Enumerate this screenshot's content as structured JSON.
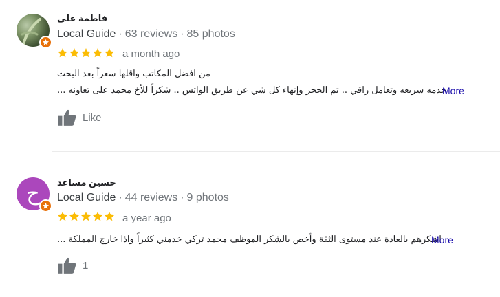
{
  "reviews": [
    {
      "author": "فاطمة علي",
      "guide_label": "Local Guide",
      "reviews_count": "63 reviews",
      "photos_count": "85 photos",
      "rating": 5,
      "time": "a month ago",
      "text_line1": "من افضل المكاتب واقلها سعراً بعد البحث",
      "text_line2": "خدمه سريعه وتعامل راقي .. تم الحجز وإنهاء كل شي عن طريق الواتس .. شكراً للأخ محمد على تعاونه ...",
      "more_label": "More",
      "like_label": "Like"
    },
    {
      "author": "حسين مساعد",
      "avatar_letter": "ح",
      "guide_label": "Local Guide",
      "reviews_count": "44 reviews",
      "photos_count": "9 photos",
      "rating": 5,
      "time": "a year ago",
      "text_line1": "اشكرهم بالعادة عند مستوى الثقة وأخص بالشكر الموظف محمد تركي خدمني كثيراً واذا خارج المملكة ...",
      "more_label": "More",
      "like_label": "1"
    }
  ],
  "colors": {
    "star": "#fbbc04",
    "badge": "#e8710a",
    "link": "#1a0dab",
    "avatar_purple": "#ab47bc"
  }
}
